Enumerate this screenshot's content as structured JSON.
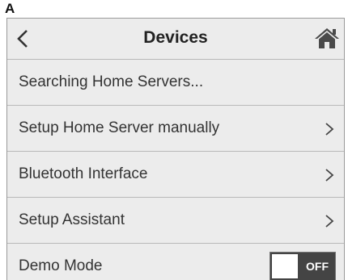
{
  "panel_label": "A",
  "header": {
    "title": "Devices",
    "back_icon": "chevron-left-icon",
    "home_icon": "home-icon"
  },
  "rows": [
    {
      "label": "Searching Home Servers...",
      "has_chevron": false
    },
    {
      "label": "Setup Home Server manually",
      "has_chevron": true
    },
    {
      "label": "Bluetooth Interface",
      "has_chevron": true
    },
    {
      "label": "Setup Assistant",
      "has_chevron": true
    },
    {
      "label": "Demo Mode",
      "has_chevron": false
    }
  ],
  "demo_mode": {
    "state": "OFF",
    "enabled": false
  },
  "colors": {
    "background": "#ececec",
    "divider": "#b9b9b9",
    "toggle_off": "#444444",
    "text": "#333333"
  }
}
